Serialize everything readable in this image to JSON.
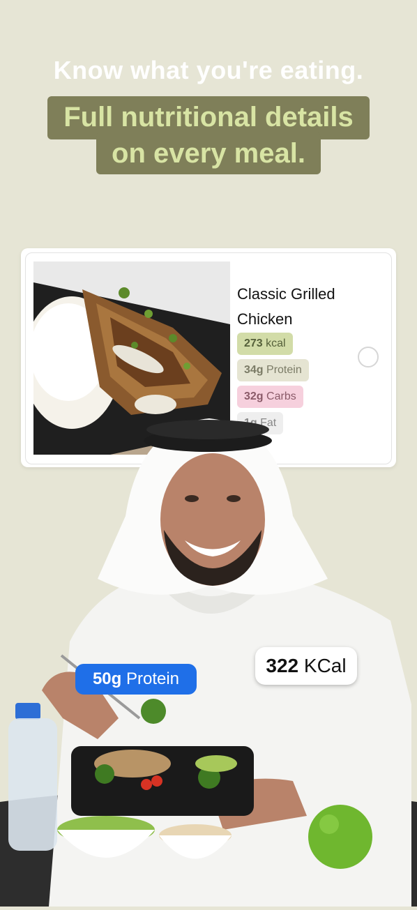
{
  "header": {
    "line1": "Know what you're eating.",
    "line2": "Full nutritional details",
    "line3": "on every meal."
  },
  "meal_card": {
    "title": "Classic Grilled Chicken",
    "tags": {
      "kcal": {
        "value": "273",
        "unit": "kcal"
      },
      "protein": {
        "value": "34g",
        "unit": "Protein"
      },
      "carbs": {
        "value": "32g",
        "unit": "Carbs"
      },
      "fat": {
        "value": "1g",
        "unit": "Fat"
      }
    }
  },
  "overlay": {
    "protein": {
      "value": "50g",
      "unit": "Protein"
    },
    "kcal": {
      "value": "322",
      "unit": "KCal"
    }
  },
  "colors": {
    "background": "#e6e5d5",
    "headline_box": "#7f7f59",
    "headline_box_text": "#d8e4a4",
    "protein_bubble": "#1f6fe8"
  }
}
